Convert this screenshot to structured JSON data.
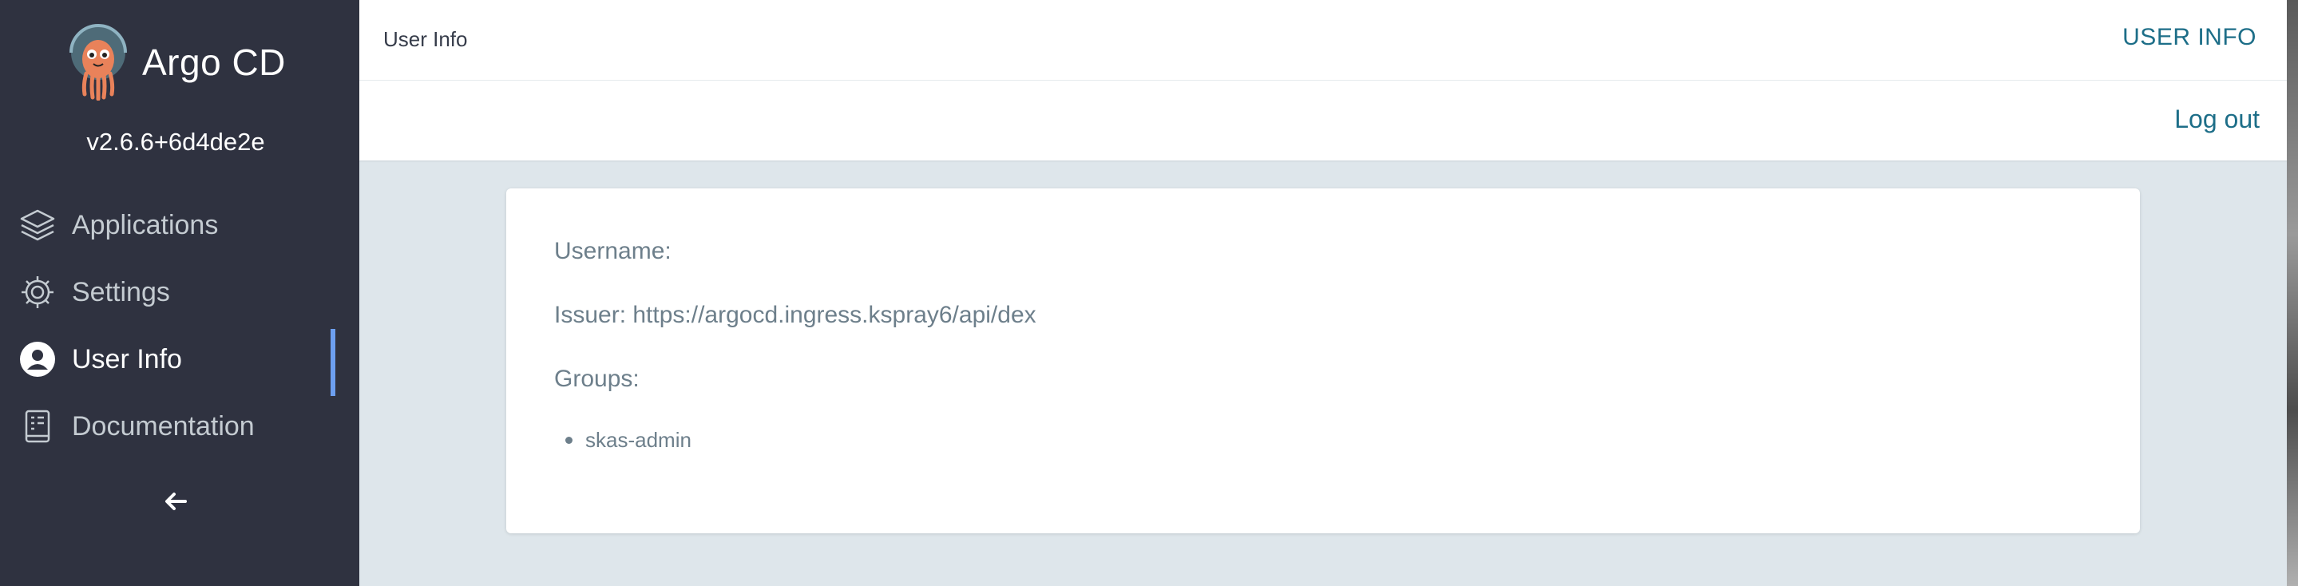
{
  "brand": {
    "name": "Argo CD",
    "version": "v2.6.6+6d4de2e",
    "logo_icon": "argo-octopus-logo"
  },
  "sidebar": {
    "items": [
      {
        "label": "Applications",
        "icon": "layers-icon",
        "active": false
      },
      {
        "label": "Settings",
        "icon": "gear-icon",
        "active": false
      },
      {
        "label": "User Info",
        "icon": "user-circle-icon",
        "active": true
      },
      {
        "label": "Documentation",
        "icon": "book-icon",
        "active": false
      }
    ],
    "collapse_icon": "arrow-left-icon"
  },
  "header": {
    "title": "User Info",
    "section_label": "USER INFO"
  },
  "toolbar": {
    "logout_label": "Log out"
  },
  "user_info": {
    "username_label": "Username:",
    "issuer_line": "Issuer: https://argocd.ingress.kspray6/api/dex",
    "groups_label": "Groups:",
    "groups": [
      "skas-admin"
    ]
  },
  "colors": {
    "sidebar_bg": "#2f3240",
    "accent": "#1d6e88",
    "active_indicator": "#6d9ff0",
    "page_bg": "#dee6eb"
  }
}
